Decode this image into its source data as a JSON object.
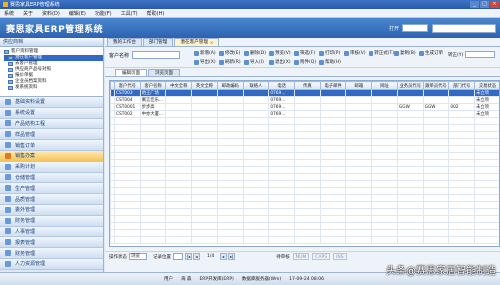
{
  "window": {
    "title": "赛思家具ERP管理系统"
  },
  "menu": [
    "系统",
    "关于",
    "资料(D)",
    "编辑(E)",
    "功能(F)",
    "工具(T)",
    "帮助(H)"
  ],
  "banner": {
    "logo": "赛思家具ERP管理系统",
    "open_label": "打开"
  },
  "sidebar": {
    "header": "供应商档",
    "tree": [
      {
        "label": "客户资料管理",
        "selected": false,
        "sub": false
      },
      {
        "label": "潜在客户管理",
        "selected": true,
        "sub": true
      },
      {
        "label": "去客户管理",
        "selected": false,
        "sub": true
      },
      {
        "label": "供应商产品号对照",
        "selected": false,
        "sub": true
      },
      {
        "label": "报价单据",
        "selected": false,
        "sub": true
      },
      {
        "label": "企业员档案资料",
        "selected": false,
        "sub": true
      },
      {
        "label": "发系统资料",
        "selected": false,
        "sub": true
      }
    ],
    "nav": [
      {
        "label": "基础资料设置",
        "active": false
      },
      {
        "label": "系统设置",
        "active": false
      },
      {
        "label": "产品结构工程",
        "active": false
      },
      {
        "label": "样品管理",
        "active": false
      },
      {
        "label": "销售订单",
        "active": false
      },
      {
        "label": "销售办案",
        "active": true
      },
      {
        "label": "采购计划",
        "active": false
      },
      {
        "label": "仓储管理",
        "active": false
      },
      {
        "label": "生产管理",
        "active": false
      },
      {
        "label": "品质管理",
        "active": false
      },
      {
        "label": "委外管理",
        "active": false
      },
      {
        "label": "財务管理",
        "active": false
      },
      {
        "label": "人事管理",
        "active": false
      },
      {
        "label": "报表管理",
        "active": false
      },
      {
        "label": "财务管理",
        "active": false
      },
      {
        "label": "人力资源管理",
        "active": false
      }
    ]
  },
  "tabs": [
    {
      "label": "我的工作台",
      "active": false
    },
    {
      "label": "部门管理",
      "active": false
    },
    {
      "label": "潜在客户管理",
      "active": true
    }
  ],
  "toolbar": {
    "customer_label": "客户名称",
    "buttons": [
      "新增(A)",
      "修改(E)",
      "删除(D)",
      "预览(V)",
      "筛选(F)",
      "打印(P)",
      "审核(V)",
      "转正式(T)",
      "复制(B)",
      "生成订单",
      "导出(X)",
      "刷新(R)",
      "导入(I)",
      "退出(X)",
      "附件(Q)",
      "帮助(H)"
    ],
    "search_label": "转正(Y)"
  },
  "subtabs": [
    {
      "label": "编辑页面",
      "active": true
    },
    {
      "label": "浏览页面",
      "active": false
    }
  ],
  "table": {
    "columns": [
      "客户代号",
      "客户名称",
      "中文全称",
      "英文全称",
      "邮政编码",
      "联络人",
      "电话",
      "传真",
      "电子邮件",
      "邮箱",
      "网址",
      "业务员代号",
      "跟单员代号",
      "部门代号",
      "交易状态"
    ],
    "rows": [
      [
        "CST003",
        "地王广场",
        "",
        "",
        "",
        "",
        "0769...",
        "",
        "",
        "",
        "",
        "",
        "",
        "",
        "未立项"
      ],
      [
        "CST004",
        "寓言佳乐...",
        "",
        "",
        "",
        "",
        "0769...",
        "",
        "",
        "",
        "",
        "",
        "",
        "",
        "未立项"
      ],
      [
        "CST0001",
        "步步高",
        "",
        "",
        "",
        "",
        "0769...",
        "",
        "",
        "",
        "",
        "GGW",
        "GGW",
        "002",
        "未立项"
      ],
      [
        "CST002",
        "中亦大厦...",
        "",
        "",
        "",
        "",
        "0769...",
        "",
        "",
        "",
        "",
        "",
        "",
        "",
        "未立项"
      ]
    ],
    "selected_row": 0
  },
  "pager": {
    "label": "操作状态",
    "state": "浏览",
    "rec_label": "记录位置",
    "position": "1/4",
    "edit_label": "待审核",
    "keys": [
      "NUM",
      "CAPS",
      "INS"
    ]
  },
  "status": {
    "items": [
      "用户",
      "海  森",
      "ERP开发库(ERP)",
      "数据库服务器(Wm)",
      "17-09-24 08:06"
    ]
  },
  "watermark": "头条@赛思家居智能制造"
}
